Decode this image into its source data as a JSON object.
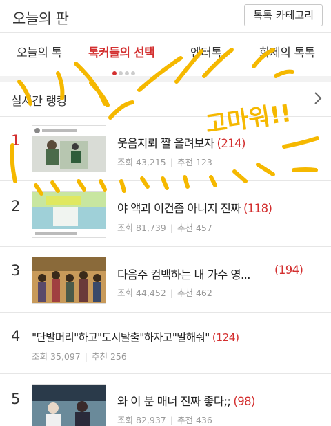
{
  "header": {
    "title": "오늘의 판",
    "category_button": "톡톡 카테고리"
  },
  "tabs": [
    {
      "label": "오늘의 톡",
      "active": false
    },
    {
      "label": "톡커들의 선택",
      "active": true
    },
    {
      "label": "엔터톡",
      "active": false
    },
    {
      "label": "화제의 톡톡",
      "active": false
    }
  ],
  "section": {
    "label": "실시간 랭킹"
  },
  "rankings": [
    {
      "rank": "1",
      "title": "웃음지뢰 짤 올려보자",
      "comments": "(214)",
      "views_label": "조회",
      "views": "43,215",
      "recs_label": "추천",
      "recs": "123"
    },
    {
      "rank": "2",
      "title": "야 액괴 이건좀 아니지 진짜",
      "comments": "(118)",
      "views_label": "조회",
      "views": "81,739",
      "recs_label": "추천",
      "recs": "457"
    },
    {
      "rank": "3",
      "title": "다음주 컴백하는 내 가수 영...",
      "comments": "(194)",
      "views_label": "조회",
      "views": "44,452",
      "recs_label": "추천",
      "recs": "462"
    },
    {
      "rank": "4",
      "title": "\"단발머리\"하고\"도시탈출\"하자고\"말해줘\"",
      "comments": "(124)",
      "views_label": "조회",
      "views": "35,097",
      "recs_label": "추천",
      "recs": "256"
    },
    {
      "rank": "5",
      "title": "와 이 분 매너 진짜 좋다;;",
      "comments": "(98)",
      "views_label": "조회",
      "views": "82,937",
      "recs_label": "추천",
      "recs": "436"
    }
  ],
  "overlay": {
    "handwriting": "고마워!!"
  },
  "colors": {
    "accent": "#d32f2f",
    "scribble": "#f5b800"
  }
}
